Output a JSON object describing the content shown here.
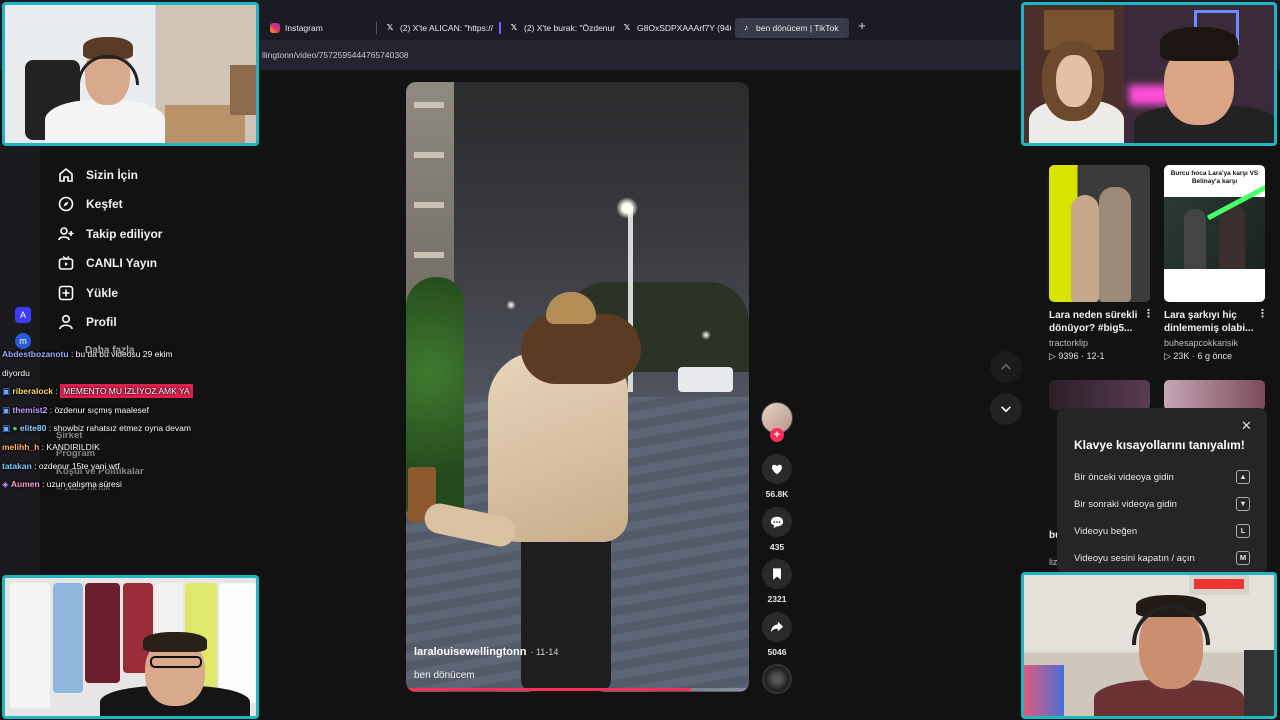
{
  "browser": {
    "tabs": [
      {
        "label": "Instagram",
        "icon": "instagram-icon"
      },
      {
        "label": "(2) X'te ALICAN: \"https://",
        "icon": "x-icon"
      },
      {
        "label": "(2) X'te burak: \"Özdenur u",
        "icon": "x-icon"
      },
      {
        "label": "G8OxSDPXAAArf7Y (946×",
        "icon": "x-icon"
      },
      {
        "label": "ben dönücem | TikTok",
        "icon": "tiktok-icon",
        "active": true
      }
    ],
    "url": "llingtonn/video/7572595444765740308"
  },
  "nav": {
    "items": [
      {
        "label": "Sizin İçin",
        "icon": "home-icon"
      },
      {
        "label": "Keşfet",
        "icon": "compass-icon"
      },
      {
        "label": "Takip ediliyor",
        "icon": "user-plus-icon"
      },
      {
        "label": "CANLI Yayın",
        "icon": "live-icon"
      },
      {
        "label": "Yükle",
        "icon": "upload-icon"
      },
      {
        "label": "Profil",
        "icon": "profile-icon"
      }
    ],
    "faded": {
      "daha": "Daha fazla",
      "footer1": "Şirket",
      "footer2": "Program",
      "footer3": "Koşul ve Politikalar",
      "copyright": "© 2025 TikTok"
    }
  },
  "video": {
    "username": "laralouisewellingtonn",
    "date": "11-14",
    "description": "ben dönücem",
    "progress": 0.83
  },
  "actions": {
    "likes": "56.8K",
    "comments": "435",
    "saves": "2321",
    "shares": "5046"
  },
  "recommendations": [
    {
      "title": "Lara neden sürekli dönüyor? #big5...",
      "author": "tractorklip",
      "views": "9396",
      "date": "12-1"
    },
    {
      "title": "Lara şarkıyı hiç dinlememiş olabi...",
      "author": "buhesapcokkarisik",
      "views": "23K",
      "date": "6 g önce",
      "thumb_text": "Burcu hoca Lara'ya karşı VS Belinay'a karşı"
    },
    {
      "title": "bu",
      "author": "liz"
    }
  ],
  "shortcuts": {
    "title": "Klavye kısayollarını tanıyalım!",
    "rows": [
      {
        "label": "Bir önceki videoya gidin",
        "key": "▲"
      },
      {
        "label": "Bir sonraki videoya gidin",
        "key": "▼"
      },
      {
        "label": "Videoyu beğen",
        "key": "L"
      },
      {
        "label": "Videoyu sesini kapatın / açın",
        "key": "M"
      }
    ]
  },
  "chat": [
    {
      "user": "Abdestbozanotu",
      "text": " : bu da bu videosu 29 ekim"
    },
    {
      "user": "",
      "text": "diyordu"
    },
    {
      "user": "riberalock",
      "text": "MEMENTO MU İZLİYOZ AMK YA",
      "highlight": true
    },
    {
      "user": "themist2",
      "text": " : özdenur sıçmış maalesef"
    },
    {
      "user": "elite80",
      "text": " : showbiz rahatsız etmez oyna devam"
    },
    {
      "user": "melihh_h",
      "text": " : KANDIRILDIK"
    },
    {
      "user": "tatakan",
      "text": " : ozdenur 15te yani wtf"
    },
    {
      "user": "Aumen",
      "text": " : uzun çalışma süresi"
    }
  ],
  "colors": {
    "accent": "#fe2c55",
    "cam_border": "#1fb6c3",
    "page_bg": "#121212"
  }
}
